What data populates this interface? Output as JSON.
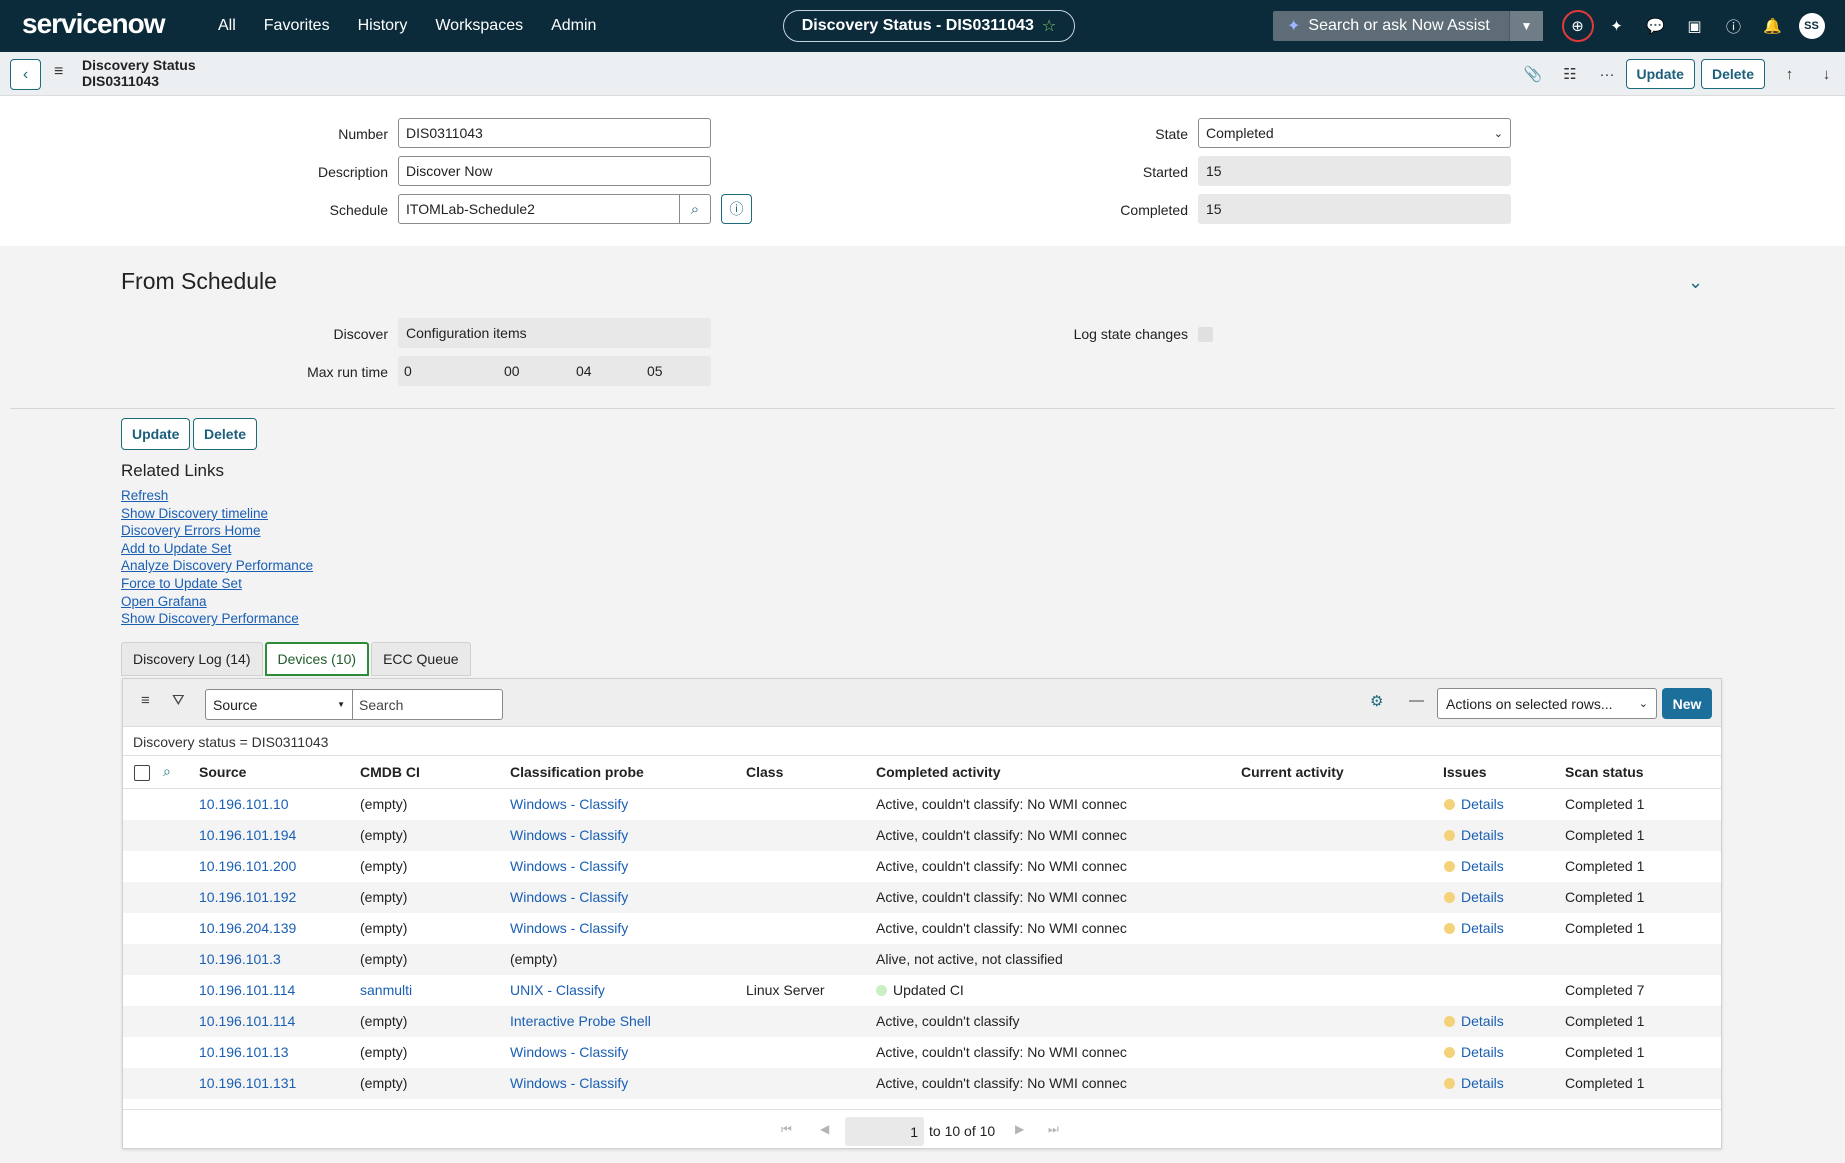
{
  "nav": {
    "logo": "servicenow",
    "menu": [
      "All",
      "Favorites",
      "History",
      "Workspaces",
      "Admin"
    ],
    "title": "Discovery Status - DIS0311043",
    "search_placeholder": "Search or ask Now Assist",
    "avatar": "SS"
  },
  "header": {
    "title_line1": "Discovery Status",
    "title_line2": "DIS0311043",
    "update_label": "Update",
    "delete_label": "Delete"
  },
  "form": {
    "number_label": "Number",
    "number_value": "DIS0311043",
    "description_label": "Description",
    "description_value": "Discover Now",
    "schedule_label": "Schedule",
    "schedule_value": "ITOMLab-Schedule2",
    "state_label": "State",
    "state_value": "Completed",
    "started_label": "Started",
    "started_value": "15",
    "completed_label": "Completed",
    "completed_value": "15"
  },
  "schedule_section": {
    "title": "From Schedule",
    "discover_label": "Discover",
    "discover_value": "Configuration items",
    "max_run_label": "Max run time",
    "max_run_days": "0",
    "max_run_hours": "00",
    "max_run_minutes": "04",
    "max_run_seconds": "05",
    "log_state_label": "Log state changes"
  },
  "bottom_buttons": {
    "update_label": "Update",
    "delete_label": "Delete"
  },
  "related": {
    "title": "Related Links",
    "links": [
      "Refresh",
      "Show Discovery timeline",
      "Discovery Errors Home",
      "Add to Update Set",
      "Analyze Discovery Performance",
      "Force to Update Set",
      "Open Grafana",
      "Show Discovery Performance"
    ]
  },
  "tabs": [
    "Discovery Log (14)",
    "Devices (10)",
    "ECC Queue"
  ],
  "list": {
    "filter_field": "Source",
    "search_placeholder": "Search",
    "actions_label": "Actions on selected rows...",
    "new_label": "New",
    "breadcrumb": "Discovery status = DIS0311043",
    "columns": [
      "Source",
      "CMDB CI",
      "Classification probe",
      "Class",
      "Completed activity",
      "Current activity",
      "Issues",
      "Scan status"
    ],
    "rows": [
      {
        "source": "10.196.101.10",
        "ci": "(empty)",
        "probe": "Windows - Classify",
        "class": "",
        "completed": "Active, couldn't classify: No WMI connec",
        "current": "",
        "issues": "Details",
        "scan": "Completed 1"
      },
      {
        "source": "10.196.101.194",
        "ci": "(empty)",
        "probe": "Windows - Classify",
        "class": "",
        "completed": "Active, couldn't classify: No WMI connec",
        "current": "",
        "issues": "Details",
        "scan": "Completed 1"
      },
      {
        "source": "10.196.101.200",
        "ci": "(empty)",
        "probe": "Windows - Classify",
        "class": "",
        "completed": "Active, couldn't classify: No WMI connec",
        "current": "",
        "issues": "Details",
        "scan": "Completed 1"
      },
      {
        "source": "10.196.101.192",
        "ci": "(empty)",
        "probe": "Windows - Classify",
        "class": "",
        "completed": "Active, couldn't classify: No WMI connec",
        "current": "",
        "issues": "Details",
        "scan": "Completed 1"
      },
      {
        "source": "10.196.204.139",
        "ci": "(empty)",
        "probe": "Windows - Classify",
        "class": "",
        "completed": "Active, couldn't classify: No WMI connec",
        "current": "",
        "issues": "Details",
        "scan": "Completed 1"
      },
      {
        "source": "10.196.101.3",
        "ci": "(empty)",
        "probe": "(empty)",
        "class": "",
        "completed": "Alive, not active, not classified",
        "current": "",
        "issues": "",
        "scan": ""
      },
      {
        "source": "10.196.101.114",
        "ci": "sanmulti",
        "probe": "UNIX - Classify",
        "class": "Linux Server",
        "completed": "Updated CI",
        "current": "",
        "issues": "",
        "scan": "Completed 7"
      },
      {
        "source": "10.196.101.114",
        "ci": "(empty)",
        "probe": "Interactive Probe Shell",
        "class": "",
        "completed": "Active, couldn't classify",
        "current": "",
        "issues": "Details",
        "scan": "Completed 1"
      },
      {
        "source": "10.196.101.13",
        "ci": "(empty)",
        "probe": "Windows - Classify",
        "class": "",
        "completed": "Active, couldn't classify: No WMI connec",
        "current": "",
        "issues": "Details",
        "scan": "Completed 1"
      },
      {
        "source": "10.196.101.131",
        "ci": "(empty)",
        "probe": "Windows - Classify",
        "class": "",
        "completed": "Active, couldn't classify: No WMI connec",
        "current": "",
        "issues": "Details",
        "scan": "Completed 1"
      }
    ],
    "pager_page": "1",
    "pager_text": "to 10 of 10"
  },
  "colors": {
    "nav_bg": "#0b2a3a",
    "accent": "#1c6b7a",
    "link": "#1a5fb4",
    "issue_dot": "#f4d27a",
    "ok_dot": "#c9efc3",
    "new_button": "#1b6f9a"
  }
}
